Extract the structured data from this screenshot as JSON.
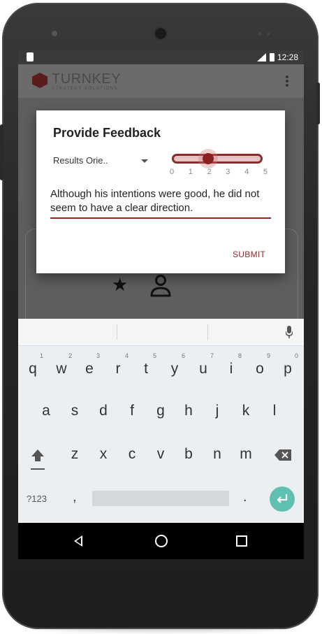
{
  "status_bar": {
    "time": "12:28"
  },
  "app_bar": {
    "logo_text": "TURNKEY",
    "logo_subtext": "STRATEGY SOLUTIONS"
  },
  "dialog": {
    "title": "Provide Feedback",
    "dropdown_value": "Results Orie..",
    "slider": {
      "value": 2,
      "min": 0,
      "max": 5,
      "labels": [
        "0",
        "1",
        "2",
        "3",
        "4",
        "5"
      ]
    },
    "feedback_text": "Although his intentions were good, he did not seem to have a clear direction.",
    "submit_label": "SUBMIT"
  },
  "keyboard": {
    "row1": [
      "q",
      "w",
      "e",
      "r",
      "t",
      "y",
      "u",
      "i",
      "o",
      "p"
    ],
    "row1_hints": [
      "1",
      "2",
      "3",
      "4",
      "5",
      "6",
      "7",
      "8",
      "9",
      "0"
    ],
    "row2": [
      "a",
      "s",
      "d",
      "f",
      "g",
      "h",
      "j",
      "k",
      "l"
    ],
    "row3": [
      "z",
      "x",
      "c",
      "v",
      "b",
      "n",
      "m"
    ],
    "symbols_label": "?123",
    "comma": ",",
    "period": "."
  },
  "colors": {
    "accent": "#8b2c2c",
    "enter": "#5fbfb0",
    "scrim": "#5e5e5e"
  },
  "icons": [
    "star-icon",
    "person-icon",
    "mic-icon",
    "shift-icon",
    "backspace-icon",
    "enter-icon",
    "back-icon",
    "home-icon",
    "recents-icon"
  ]
}
